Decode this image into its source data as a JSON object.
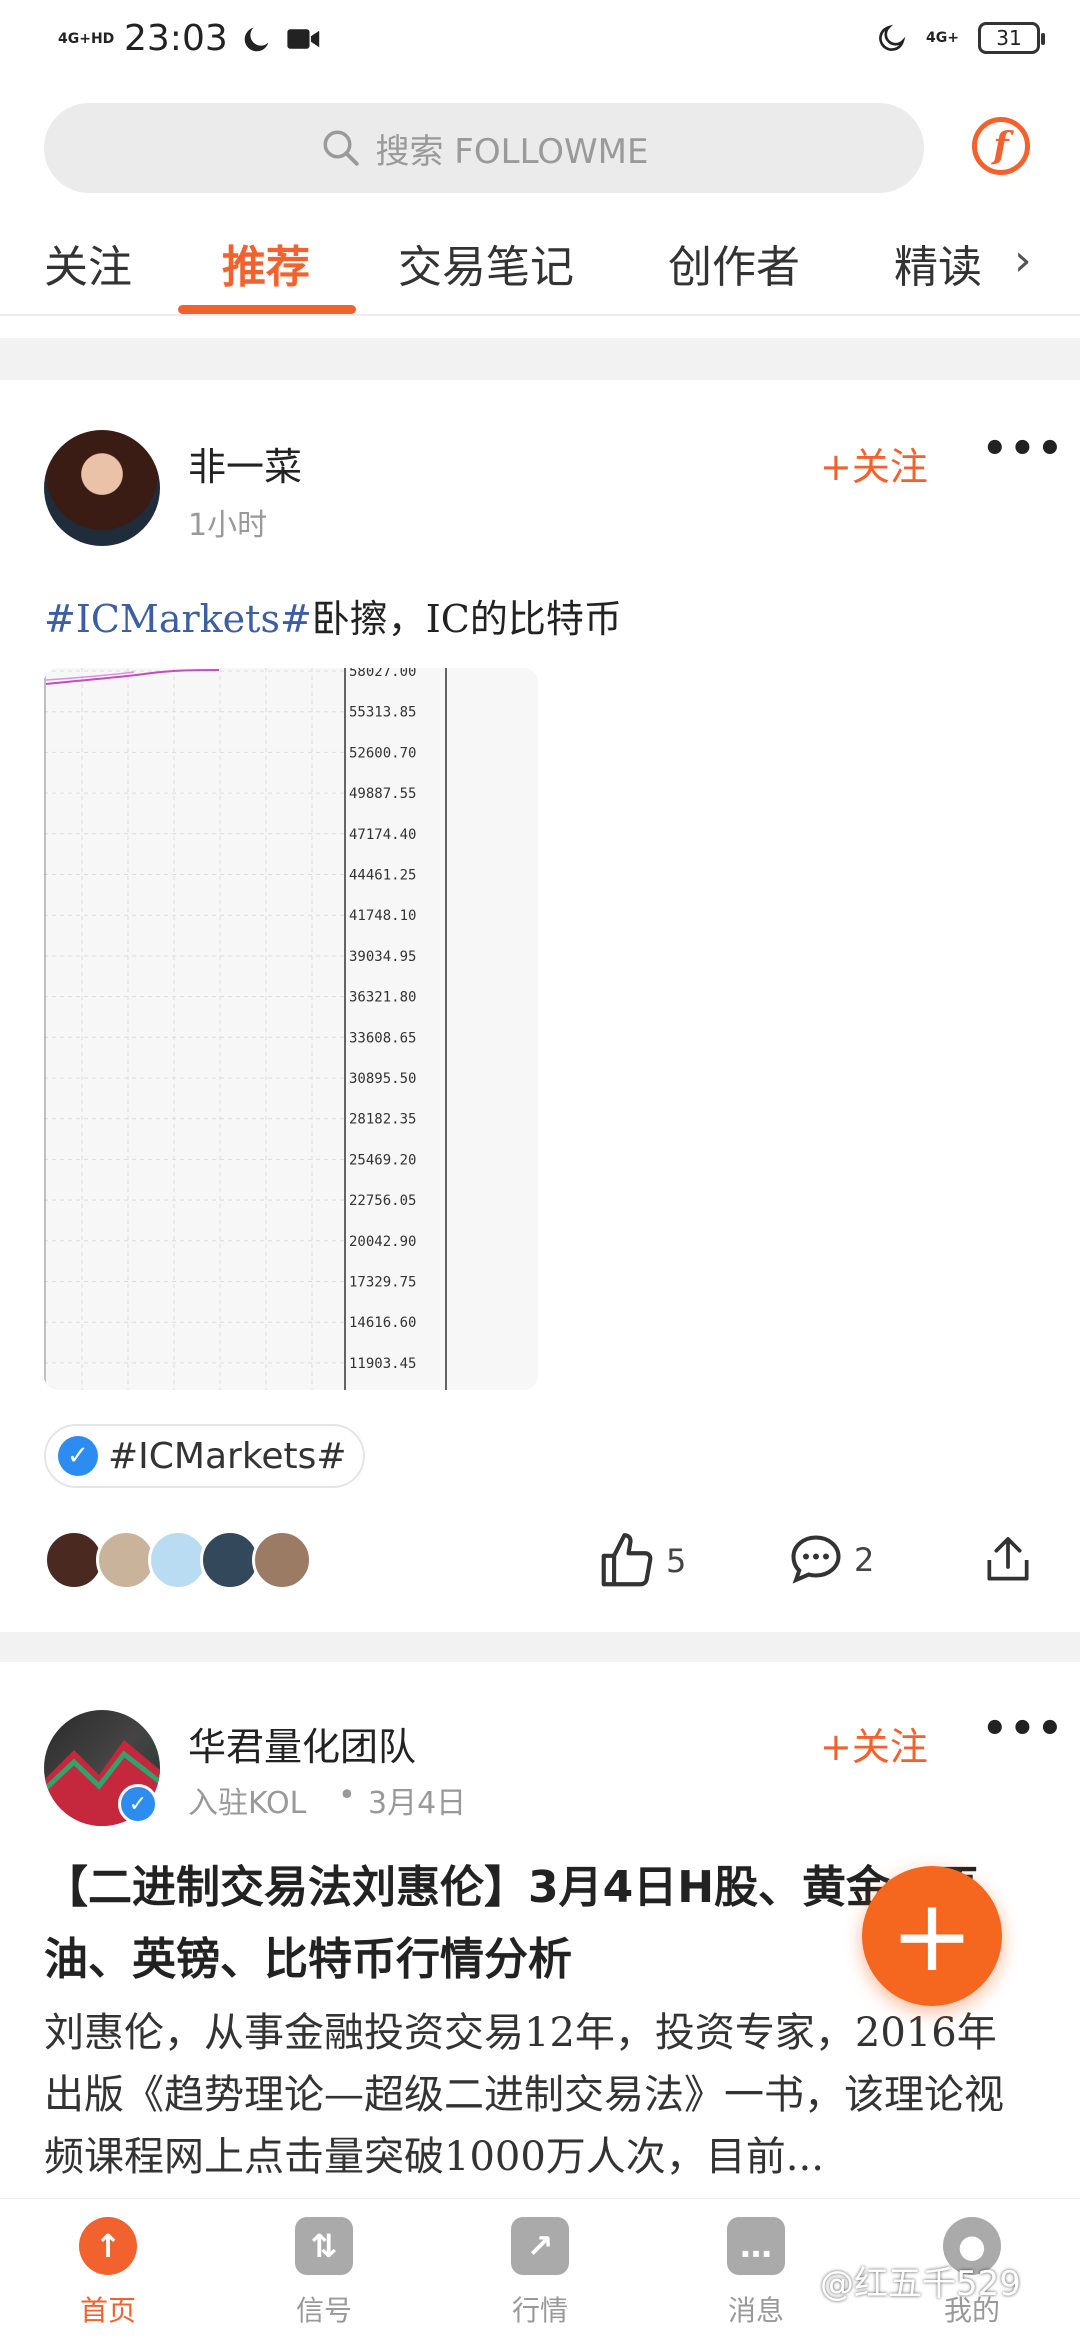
{
  "status_bar": {
    "network_left": "4G+HD",
    "time": "23:03",
    "network_right": "4G+",
    "battery": "31"
  },
  "search": {
    "placeholder": "搜索 FOLLOWME"
  },
  "tabs": [
    {
      "label": "关注",
      "active": false
    },
    {
      "label": "推荐",
      "active": true
    },
    {
      "label": "交易笔记",
      "active": false
    },
    {
      "label": "创作者",
      "active": false
    },
    {
      "label": "精读",
      "active": false
    }
  ],
  "post1": {
    "username": "非一菜",
    "time": "1小时",
    "follow_label": "+关注",
    "hashtag": "#ICMarkets#",
    "text": "卧擦，IC的比特币",
    "topic_chip": "#ICMarkets#",
    "likes": "5",
    "comments": "2",
    "chart_axis": [
      "58027.00",
      "55313.85",
      "52600.70",
      "49887.55",
      "47174.40",
      "44461.25",
      "41748.10",
      "39034.95",
      "36321.80",
      "33608.65",
      "30895.50",
      "28182.35",
      "25469.20",
      "22756.05",
      "20042.90",
      "17329.75",
      "14616.60",
      "11903.45"
    ],
    "avatar_colors": [
      "#4a2a20",
      "#c9b39a",
      "#b9dcf2",
      "#33485a",
      "#9c7b64"
    ]
  },
  "post2": {
    "username": "华君量化团队",
    "badge": "入驻KOL",
    "dot": "•",
    "date": "3月4日",
    "follow_label": "+关注",
    "title": "【二进制交易法刘惠伦】3月4日H股、黄金、原油、英镑、比特币行情分析",
    "summary": "刘惠伦，从事金融投资交易12年，投资专家，2016年出版《趋势理论—超级二进制交易法》一书，该理论视频课程网上点击量突破1000万人次，目前..."
  },
  "bottom_nav": [
    {
      "label": "首页",
      "icon": "home-icon",
      "active": true
    },
    {
      "label": "信号",
      "icon": "signal-icon",
      "active": false
    },
    {
      "label": "行情",
      "icon": "market-icon",
      "active": false
    },
    {
      "label": "消息",
      "icon": "message-icon",
      "active": false
    },
    {
      "label": "我的",
      "icon": "profile-icon",
      "active": false
    }
  ],
  "watermark": "@红五千529",
  "colors": {
    "accent": "#f2622e",
    "hashtag": "#3b5fa0",
    "verified": "#2d8cf0"
  }
}
